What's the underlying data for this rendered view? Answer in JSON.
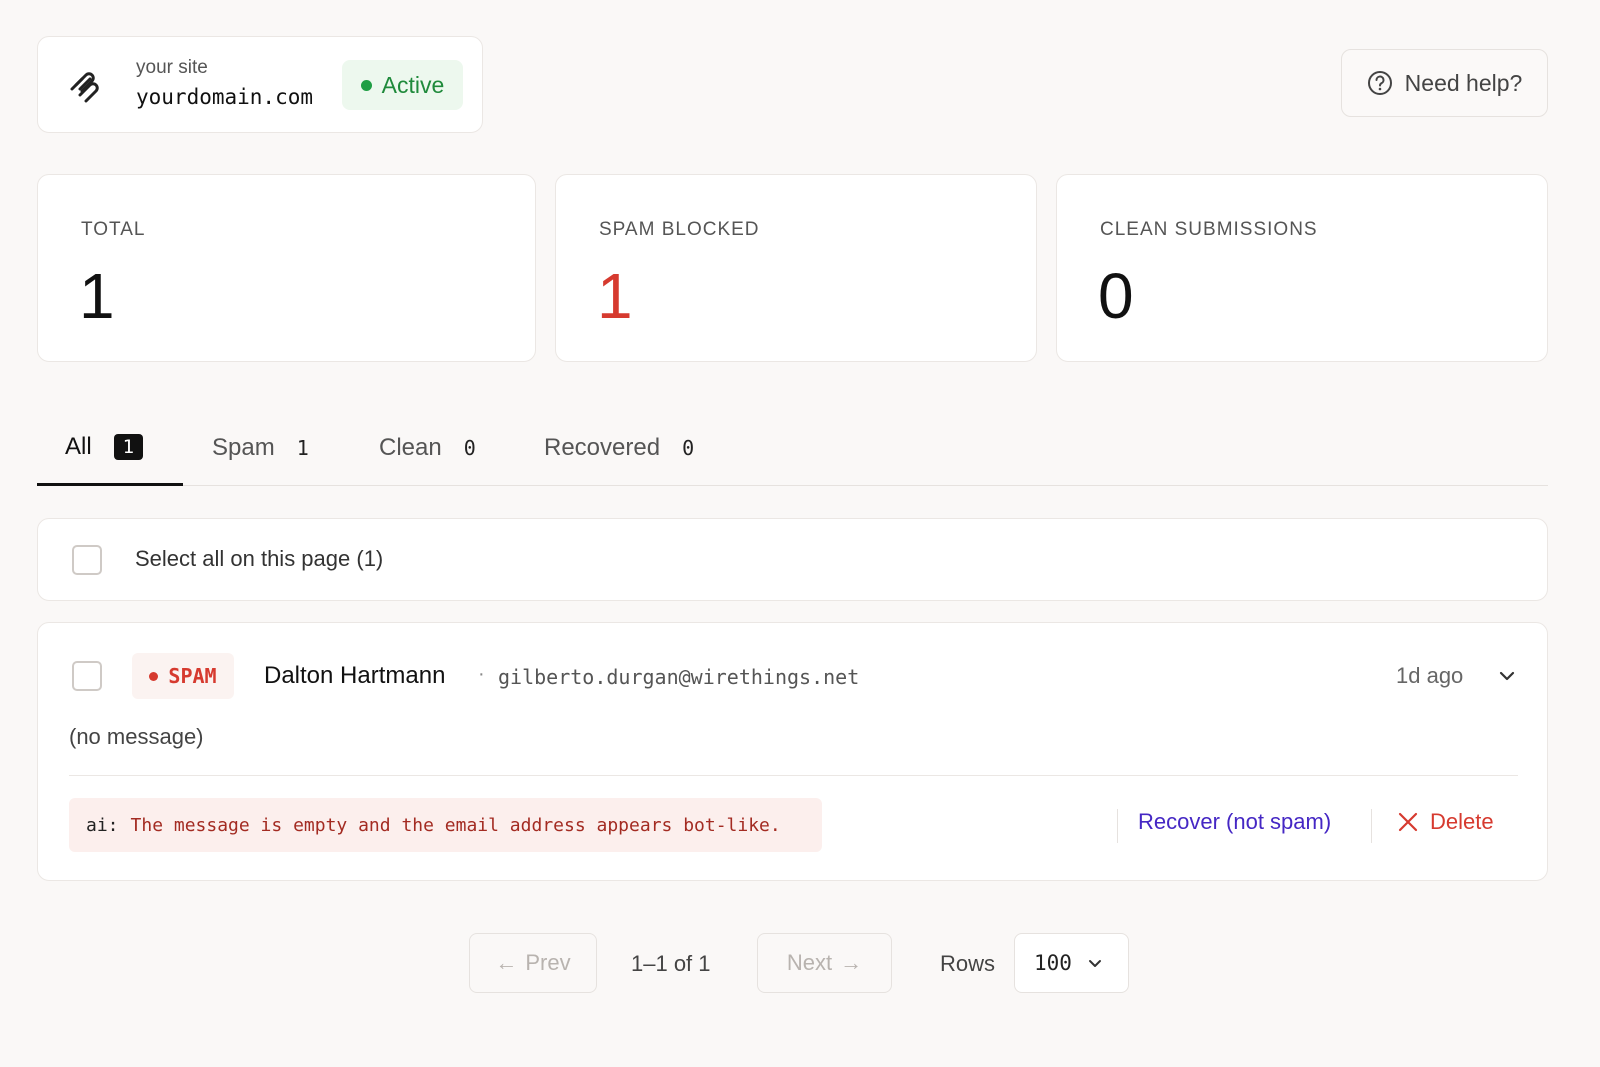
{
  "site": {
    "label": "your site",
    "domain": "yourdomain.com",
    "status": "Active",
    "logo_icon": "squarespace-logo-icon"
  },
  "help": {
    "label": "Need help?",
    "icon": "question-circle-icon"
  },
  "stats": {
    "total": {
      "label": "TOTAL",
      "value": "1"
    },
    "spam": {
      "label": "SPAM BLOCKED",
      "value": "1"
    },
    "clean": {
      "label": "CLEAN SUBMISSIONS",
      "value": "0"
    }
  },
  "tabs": [
    {
      "label": "All",
      "count": "1",
      "active": true
    },
    {
      "label": "Spam",
      "count": "1"
    },
    {
      "label": "Clean",
      "count": "0"
    },
    {
      "label": "Recovered",
      "count": "0"
    }
  ],
  "select_all": {
    "label": "Select all on this page (1)"
  },
  "submission": {
    "badge": "SPAM",
    "name": "Dalton Hartmann",
    "separator": "·",
    "email": "gilberto.durgan@wirethings.net",
    "time": "1d ago",
    "message": "(no message)",
    "ai_prefix": "ai:",
    "ai_reason": "The message is empty and the email address appears bot-like.",
    "recover_label": "Recover (not spam)",
    "delete_label": "Delete"
  },
  "pagination": {
    "prev_label": "Prev",
    "prev_arrow": "←",
    "next_label": "Next",
    "next_arrow": "→",
    "info": "1–1 of 1",
    "rows_label": "Rows",
    "rows_value": "100"
  },
  "colors": {
    "active_green": "#1f8a3b",
    "spam_red": "#d63a2f",
    "recover_purple": "#4527c4",
    "background": "#faf8f7"
  }
}
